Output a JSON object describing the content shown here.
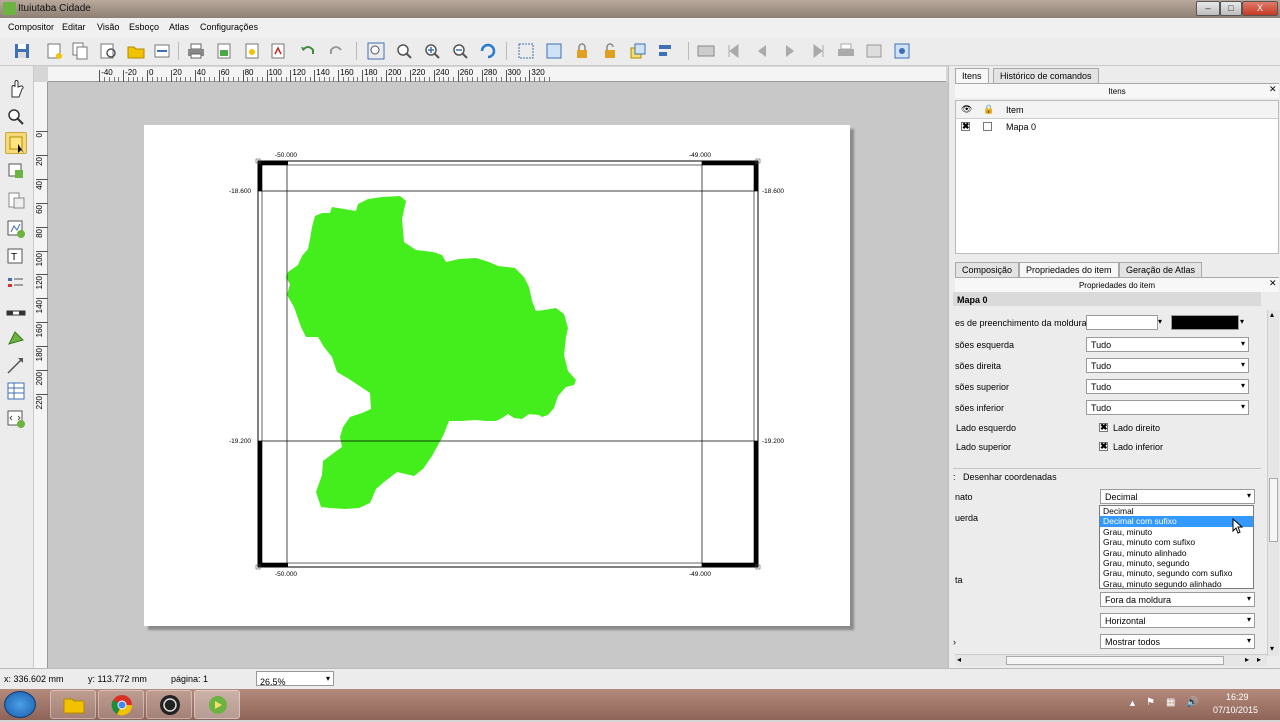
{
  "window": {
    "title": "Ituiutaba Cidade",
    "controls": [
      "–",
      "□",
      "X"
    ]
  },
  "menu": [
    "Compositor",
    "Editar",
    "Visão",
    "Esboço",
    "Atlas",
    "Configurações"
  ],
  "ruler": {
    "h_ticks": [
      "-40",
      "-20",
      "0",
      "20",
      "40",
      "60",
      "80",
      "100",
      "120",
      "140",
      "160",
      "180",
      "200",
      "220",
      "240",
      "260",
      "280",
      "300",
      "320"
    ],
    "v_ticks": [
      "0",
      "20",
      "40",
      "60",
      "80",
      "100",
      "120",
      "140",
      "160",
      "180",
      "200",
      "220"
    ]
  },
  "map": {
    "top_labels": [
      "-50.000",
      "-49.000"
    ],
    "bottom_labels": [
      "-50.000",
      "-49.000"
    ],
    "left_labels": [
      "-18.600",
      "-19.200"
    ],
    "right_labels": [
      "-18.600",
      "-19.200"
    ],
    "fill_color": "#44ee1c"
  },
  "items_panel": {
    "tabs": [
      "Itens",
      "Histórico de comandos"
    ],
    "header": "Itens",
    "column_item": "Item",
    "rows": [
      {
        "checked": true,
        "locked": false,
        "name": "Mapa 0"
      }
    ]
  },
  "props_panel": {
    "tabs": [
      "Composição",
      "Propriedades do item",
      "Geração de Atlas"
    ],
    "header": "Propriedades do item",
    "section_title": "Mapa 0",
    "fill_label": "es de preenchimento da moldura",
    "rows": [
      {
        "label": "sões esquerda",
        "value": "Tudo"
      },
      {
        "label": "sões direita",
        "value": "Tudo"
      },
      {
        "label": "sões superior",
        "value": "Tudo"
      },
      {
        "label": "sões inferior",
        "value": "Tudo"
      }
    ],
    "checks": [
      {
        "label": "Lado esquerdo",
        "checked": false
      },
      {
        "label": "Lado direito",
        "checked": true
      },
      {
        "label": "Lado superior",
        "checked": false
      },
      {
        "label": "Lado inferior",
        "checked": true
      }
    ],
    "draw_coords_label": "Desenhar coordenadas",
    "format_label": "nato",
    "format_value": "Decimal",
    "left_label": "uerda",
    "ta_label": "ta",
    "options": [
      "Decimal",
      "Decimal com sufixo",
      "Grau, minuto",
      "Grau, minuto com sufixo",
      "Grau, minuto alinhado",
      "Grau, minuto, segundo",
      "Grau, minuto, segundo com sufixo",
      "Grau, minuto segundo alinhado"
    ],
    "selected_option": "Decimal com sufixo",
    "position_value": "Fora da moldura",
    "direction_value": "Horizontal",
    "show_value": "Mostrar todos"
  },
  "status": {
    "x": "x: 336.602 mm",
    "y": "y: 113.772 mm",
    "page": "página: 1",
    "zoom": "26.5%"
  },
  "clock": {
    "time": "16:29",
    "date": "07/10/2015"
  }
}
